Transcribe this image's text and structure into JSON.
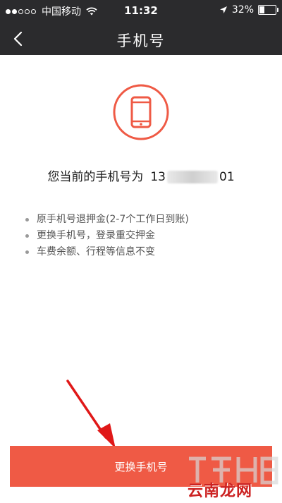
{
  "status_bar": {
    "carrier": "中国移动",
    "time": "11:32",
    "battery": "32%"
  },
  "nav": {
    "title": "手机号"
  },
  "content": {
    "current_label": "您当前的手机号为",
    "number_prefix": "13",
    "number_suffix": "01",
    "bullets": [
      "原手机号退押金(2-7个工作日到账)",
      "更换手机号，登录重交押金",
      "车费余额、行程等信息不变"
    ]
  },
  "actions": {
    "change_button_label": "更换手机号"
  },
  "watermark": {
    "text": "云南龙网"
  },
  "colors": {
    "accent": "#ef5a45",
    "bar": "#2b2b2d"
  }
}
